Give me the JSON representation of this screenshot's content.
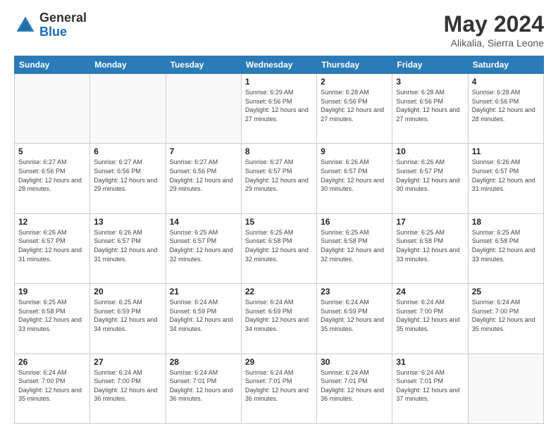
{
  "header": {
    "logo_general": "General",
    "logo_blue": "Blue",
    "title": "May 2024",
    "subtitle": "Alikalia, Sierra Leone"
  },
  "days_of_week": [
    "Sunday",
    "Monday",
    "Tuesday",
    "Wednesday",
    "Thursday",
    "Friday",
    "Saturday"
  ],
  "weeks": [
    [
      {
        "day": "",
        "info": ""
      },
      {
        "day": "",
        "info": ""
      },
      {
        "day": "",
        "info": ""
      },
      {
        "day": "1",
        "info": "Sunrise: 6:29 AM\nSunset: 6:56 PM\nDaylight: 12 hours and 27 minutes."
      },
      {
        "day": "2",
        "info": "Sunrise: 6:28 AM\nSunset: 6:56 PM\nDaylight: 12 hours and 27 minutes."
      },
      {
        "day": "3",
        "info": "Sunrise: 6:28 AM\nSunset: 6:56 PM\nDaylight: 12 hours and 27 minutes."
      },
      {
        "day": "4",
        "info": "Sunrise: 6:28 AM\nSunset: 6:56 PM\nDaylight: 12 hours and 28 minutes."
      }
    ],
    [
      {
        "day": "5",
        "info": "Sunrise: 6:27 AM\nSunset: 6:56 PM\nDaylight: 12 hours and 28 minutes."
      },
      {
        "day": "6",
        "info": "Sunrise: 6:27 AM\nSunset: 6:56 PM\nDaylight: 12 hours and 29 minutes."
      },
      {
        "day": "7",
        "info": "Sunrise: 6:27 AM\nSunset: 6:56 PM\nDaylight: 12 hours and 29 minutes."
      },
      {
        "day": "8",
        "info": "Sunrise: 6:27 AM\nSunset: 6:57 PM\nDaylight: 12 hours and 29 minutes."
      },
      {
        "day": "9",
        "info": "Sunrise: 6:26 AM\nSunset: 6:57 PM\nDaylight: 12 hours and 30 minutes."
      },
      {
        "day": "10",
        "info": "Sunrise: 6:26 AM\nSunset: 6:57 PM\nDaylight: 12 hours and 30 minutes."
      },
      {
        "day": "11",
        "info": "Sunrise: 6:26 AM\nSunset: 6:57 PM\nDaylight: 12 hours and 31 minutes."
      }
    ],
    [
      {
        "day": "12",
        "info": "Sunrise: 6:26 AM\nSunset: 6:57 PM\nDaylight: 12 hours and 31 minutes."
      },
      {
        "day": "13",
        "info": "Sunrise: 6:26 AM\nSunset: 6:57 PM\nDaylight: 12 hours and 31 minutes."
      },
      {
        "day": "14",
        "info": "Sunrise: 6:25 AM\nSunset: 6:57 PM\nDaylight: 12 hours and 32 minutes."
      },
      {
        "day": "15",
        "info": "Sunrise: 6:25 AM\nSunset: 6:58 PM\nDaylight: 12 hours and 32 minutes."
      },
      {
        "day": "16",
        "info": "Sunrise: 6:25 AM\nSunset: 6:58 PM\nDaylight: 12 hours and 32 minutes."
      },
      {
        "day": "17",
        "info": "Sunrise: 6:25 AM\nSunset: 6:58 PM\nDaylight: 12 hours and 33 minutes."
      },
      {
        "day": "18",
        "info": "Sunrise: 6:25 AM\nSunset: 6:58 PM\nDaylight: 12 hours and 33 minutes."
      }
    ],
    [
      {
        "day": "19",
        "info": "Sunrise: 6:25 AM\nSunset: 6:58 PM\nDaylight: 12 hours and 33 minutes."
      },
      {
        "day": "20",
        "info": "Sunrise: 6:25 AM\nSunset: 6:59 PM\nDaylight: 12 hours and 34 minutes."
      },
      {
        "day": "21",
        "info": "Sunrise: 6:24 AM\nSunset: 6:59 PM\nDaylight: 12 hours and 34 minutes."
      },
      {
        "day": "22",
        "info": "Sunrise: 6:24 AM\nSunset: 6:59 PM\nDaylight: 12 hours and 34 minutes."
      },
      {
        "day": "23",
        "info": "Sunrise: 6:24 AM\nSunset: 6:59 PM\nDaylight: 12 hours and 35 minutes."
      },
      {
        "day": "24",
        "info": "Sunrise: 6:24 AM\nSunset: 7:00 PM\nDaylight: 12 hours and 35 minutes."
      },
      {
        "day": "25",
        "info": "Sunrise: 6:24 AM\nSunset: 7:00 PM\nDaylight: 12 hours and 35 minutes."
      }
    ],
    [
      {
        "day": "26",
        "info": "Sunrise: 6:24 AM\nSunset: 7:00 PM\nDaylight: 12 hours and 35 minutes."
      },
      {
        "day": "27",
        "info": "Sunrise: 6:24 AM\nSunset: 7:00 PM\nDaylight: 12 hours and 36 minutes."
      },
      {
        "day": "28",
        "info": "Sunrise: 6:24 AM\nSunset: 7:01 PM\nDaylight: 12 hours and 36 minutes."
      },
      {
        "day": "29",
        "info": "Sunrise: 6:24 AM\nSunset: 7:01 PM\nDaylight: 12 hours and 36 minutes."
      },
      {
        "day": "30",
        "info": "Sunrise: 6:24 AM\nSunset: 7:01 PM\nDaylight: 12 hours and 36 minutes."
      },
      {
        "day": "31",
        "info": "Sunrise: 6:24 AM\nSunset: 7:01 PM\nDaylight: 12 hours and 37 minutes."
      },
      {
        "day": "",
        "info": ""
      }
    ]
  ]
}
